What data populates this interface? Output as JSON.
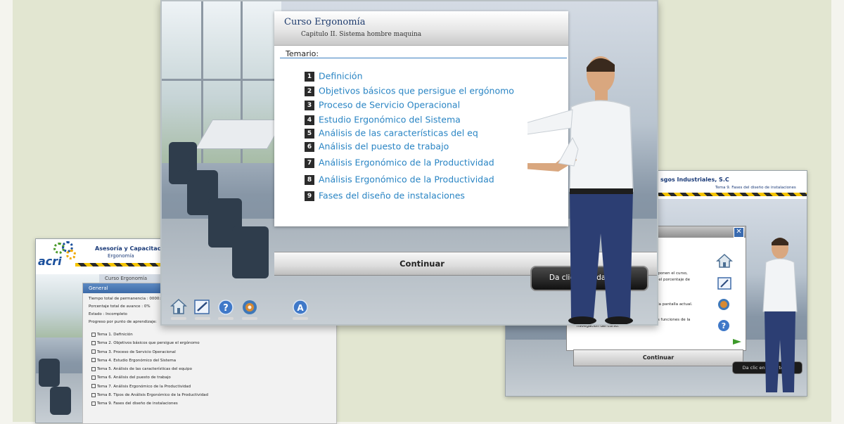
{
  "main": {
    "course_title": "Curso Ergonomía",
    "chapter": "Capitulo II. Sistema hombre maquina",
    "temario_label": "Temario:",
    "topics": [
      {
        "num": "1",
        "label": "Definición"
      },
      {
        "num": "2",
        "label": "Objetivos básicos que persigue el ergónomo"
      },
      {
        "num": "3",
        "label": "Proceso de Servicio Operacional"
      },
      {
        "num": "4",
        "label": "Estudio Ergonómico del Sistema"
      },
      {
        "num": "5",
        "label": "Análisis de las características del eq"
      },
      {
        "num": "6",
        "label": "Análisis del puesto de trabajo"
      },
      {
        "num": "7",
        "label": "Análisis Ergonómico de la Productividad"
      },
      {
        "num": "8",
        "label": "Análisis Ergonómico de la Productividad"
      },
      {
        "num": "9",
        "label": "Fases del diseño de instalaciones"
      }
    ],
    "continue_label": "Continuar",
    "tooltip": "Da clic en cada tema."
  },
  "left": {
    "logo_text": "acri",
    "company": "Asesoría y Capacitació",
    "course": "Ergonomía",
    "curso_tag": "Curso Ergonomía",
    "panel_title": "General",
    "meta": [
      "Tiempo total de permanencia : 0000:1",
      "Porcentaje total de avance : 0%",
      "Estado :  Incompleto",
      "Progreso por punto de aprendizaje:"
    ],
    "topics": [
      "Tema 1. Definición",
      "Tema 2. Objetivos básicos que persigue el ergónomo",
      "Tema 3. Proceso de Servicio Operacional",
      "Tema 4. Estudio Ergonómico del Sistema",
      "Tema 5. Análisis de las características del equipo",
      "Tema 6. Análisis del puesto de trabajo",
      "Tema 7. Análisis Ergonómico de la Productividad",
      "Tema 8. Tipos de Análisis Ergonómico de la Productividad",
      "Tema 9. Fases del diseño de instalaciones"
    ]
  },
  "right": {
    "company": "sgos Industriales, S.C",
    "tema": "Tema 9. Fases del diseño de instalaciones",
    "help_lines": [
      "mponen el curso,",
      "s, el porcentaje de",
      "a la pantalla actual.",
      "las funciones de la",
      "navegación del curso."
    ],
    "continue_label": "Continuar",
    "tooltip": "Da clic en cada tema."
  },
  "colors": {
    "accent_blue": "#2a85c4",
    "header_blue": "#1f3c6e",
    "hazard_yellow": "#f5c400"
  }
}
